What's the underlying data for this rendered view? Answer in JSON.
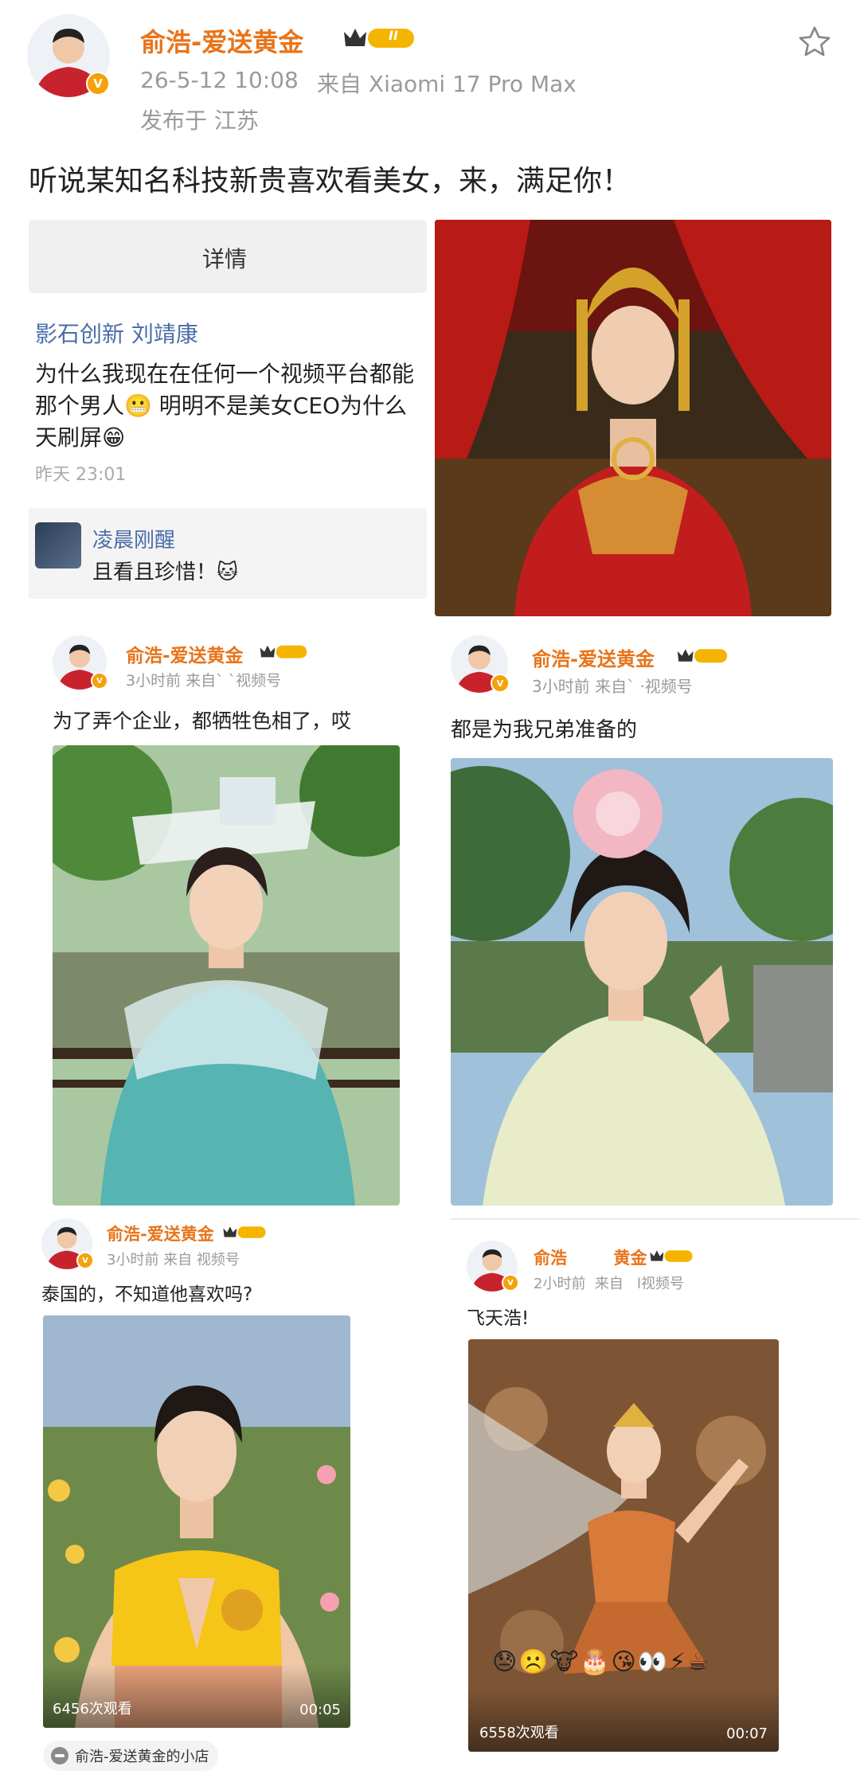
{
  "post": {
    "author": "俞浩-爱送黄金",
    "level_badge": "II",
    "time": "26-5-12 10:08",
    "source": "来自 Xiaomi 17 Pro Max",
    "location": "发布于 江苏",
    "text": "听说某知名科技新贵喜欢看美女，来，满足你！"
  },
  "quote_card": {
    "header": "详情",
    "author": "影石创新 刘靖康",
    "line1": "为什么我现在在任何一个视频平台都能",
    "line2": "那个男人😬 明明不是美女CEO为什么",
    "line3": "天刷屏😁",
    "time": "昨天 23:01",
    "reply_author": "凌晨刚醒",
    "reply_text": "且看且珍惜！🐱"
  },
  "sub_posts": [
    {
      "author": "俞浩-爱送黄金",
      "meta": "3小时前  来自`   `视频号",
      "text": "为了弄个企业，都牺牲色相了，哎"
    },
    {
      "author": "俞浩-爱送黄金",
      "meta": "3小时前  来自`  ·视频号",
      "text": "都是为我兄弟准备的"
    },
    {
      "author": "俞浩-爱送黄金",
      "meta": "3小时前  来自    视频号",
      "text": "泰国的，不知道他喜欢吗?",
      "views": "6456次观看",
      "duration": "00:05"
    },
    {
      "author": "俞浩        黄金",
      "meta": "2小时前  来自   l视频号",
      "text": "飞天浩!",
      "views": "6558次观看",
      "duration": "00:07",
      "emojis": "😓☹️🐮🎂😘👀⚡☕"
    }
  ],
  "shop": {
    "label": "俞浩-爱送黄金的小店"
  },
  "colors": {
    "name": "#e8741a",
    "meta": "#9a9a9a",
    "link_blue": "#4a6ea9",
    "badge_gold": "#f5a10a"
  }
}
